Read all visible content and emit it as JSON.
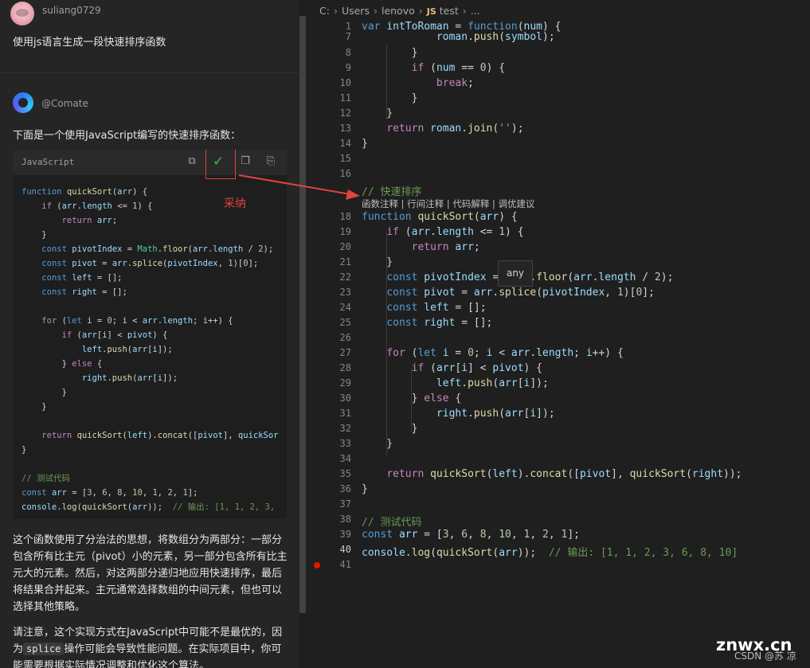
{
  "chat": {
    "user_name": "suliang0729",
    "user_message": "使用js语言生成一段快速排序函数",
    "bot_name": "@Comate",
    "intro": "下面是一个使用JavaScript编写的快速排序函数：",
    "code_lang": "JavaScript",
    "toolbar_icons": [
      "insert-icon",
      "adopt-check-icon",
      "copy-icon",
      "new-file-icon"
    ],
    "annotation": "采纳",
    "code": [
      "function quickSort(arr) {",
      "    if (arr.length <= 1) {",
      "        return arr;",
      "    }",
      "    const pivotIndex = Math.floor(arr.length / 2);",
      "    const pivot = arr.splice(pivotIndex, 1)[0];",
      "    const left = [];",
      "    const right = [];",
      "",
      "    for (let i = 0; i < arr.length; i++) {",
      "        if (arr[i] < pivot) {",
      "            left.push(arr[i]);",
      "        } else {",
      "            right.push(arr[i]);",
      "        }",
      "    }",
      "",
      "    return quickSort(left).concat([pivot], quickSor",
      "}",
      "",
      "// 测试代码",
      "const arr = [3, 6, 8, 10, 1, 2, 1];",
      "console.log(quickSort(arr));  // 输出: [1, 1, 2, 3,"
    ],
    "para1": "这个函数使用了分治法的思想，将数组分为两部分：一部分包含所有比主元（pivot）小的元素，另一部分包含所有比主元大的元素。然后，对这两部分递归地应用快速排序，最后将结果合并起来。主元通常选择数组的中间元素，但也可以选择其他策略。",
    "para2_pre": "请注意，这个实现方式在JavaScript中可能不是最优的，因为",
    "para2_code": "splice",
    "para2_post": "操作可能会导致性能问题。在实际项目中，你可能需要根据实际情况调整和优化这个算法。"
  },
  "editor": {
    "breadcrumb": [
      "C:",
      "Users",
      "lenovo",
      "test",
      "..."
    ],
    "js_badge": "JS",
    "codelens": "函数注释 | 行间注释 | 代码解释 | 调优建议",
    "hover_text": "any",
    "line_numbers": [
      "1",
      "7",
      "8",
      "9",
      "10",
      "11",
      "12",
      "13",
      "14",
      "15",
      "16",
      "18",
      "19",
      "20",
      "21",
      "22",
      "23",
      "24",
      "25",
      "26",
      "27",
      "28",
      "29",
      "30",
      "31",
      "32",
      "33",
      "34",
      "35",
      "36",
      "37",
      "38",
      "39",
      "40",
      "41"
    ],
    "active_line": "40",
    "breakpoint_line": "41",
    "lines": [
      "var intToRoman = function(num) {",
      "            roman.push(symbol);",
      "        }",
      "        if (num == 0) {",
      "            break;",
      "        }",
      "    }",
      "    return roman.join('');",
      "}",
      "",
      "",
      "function quickSort(arr) {",
      "    if (arr.length <= 1) {",
      "        return arr;",
      "    }",
      "    const pivotIndex = Math.floor(arr.length / 2);",
      "    const pivot = arr.splice(pivotIndex, 1)[0];",
      "    const left = [];",
      "    const right = [];",
      "",
      "    for (let i = 0; i < arr.length; i++) {",
      "        if (arr[i] < pivot) {",
      "            left.push(arr[i]);",
      "        } else {",
      "            right.push(arr[i]);",
      "        }",
      "    }",
      "",
      "    return quickSort(left).concat([pivot], quickSort(right));",
      "}",
      "",
      "// 测试代码",
      "const arr = [3, 6, 8, 10, 1, 2, 1];",
      "console.log(quickSort(arr));  // 输出: [1, 1, 2, 3, 6, 8, 10]",
      ""
    ],
    "comment_16": "// 快速排序"
  },
  "watermark": "znwx.cn",
  "credit": "CSDN @苏 凉"
}
